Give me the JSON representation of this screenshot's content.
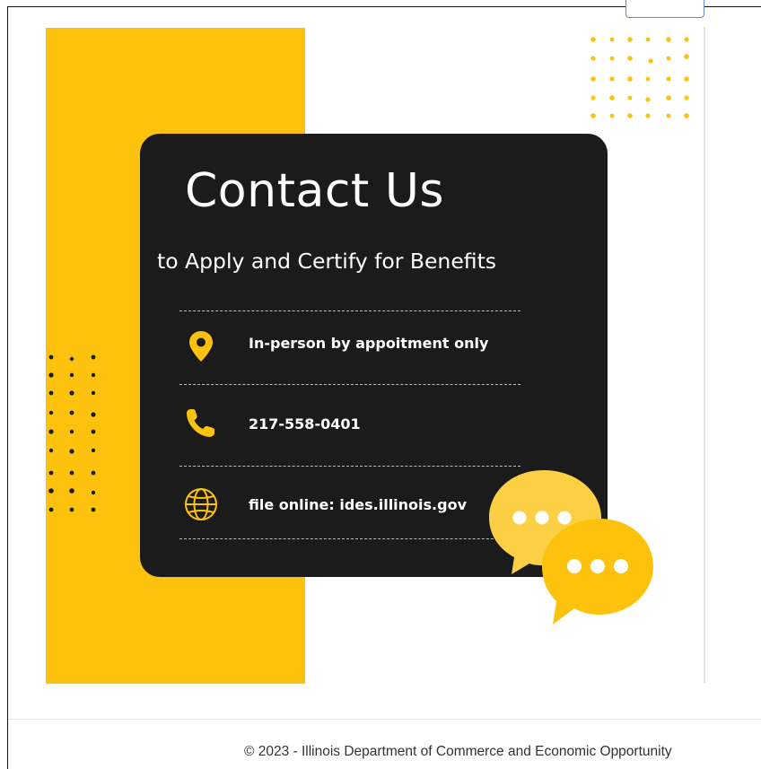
{
  "banner": {
    "title": "Contact Us",
    "subtitle": "to Apply and Certify for Benefits",
    "rows": [
      {
        "icon": "location-pin-icon",
        "text": "In-person by appoitment only"
      },
      {
        "icon": "phone-icon",
        "text": "217-558-0401"
      },
      {
        "icon": "globe-icon",
        "text": "file online: ides.illinois.gov"
      }
    ],
    "accent_color": "#fdc20d",
    "card_color": "#1c1b1b"
  },
  "footer": {
    "copyright": "© 2023 - Illinois Department of Commerce and Economic Opportunity"
  }
}
